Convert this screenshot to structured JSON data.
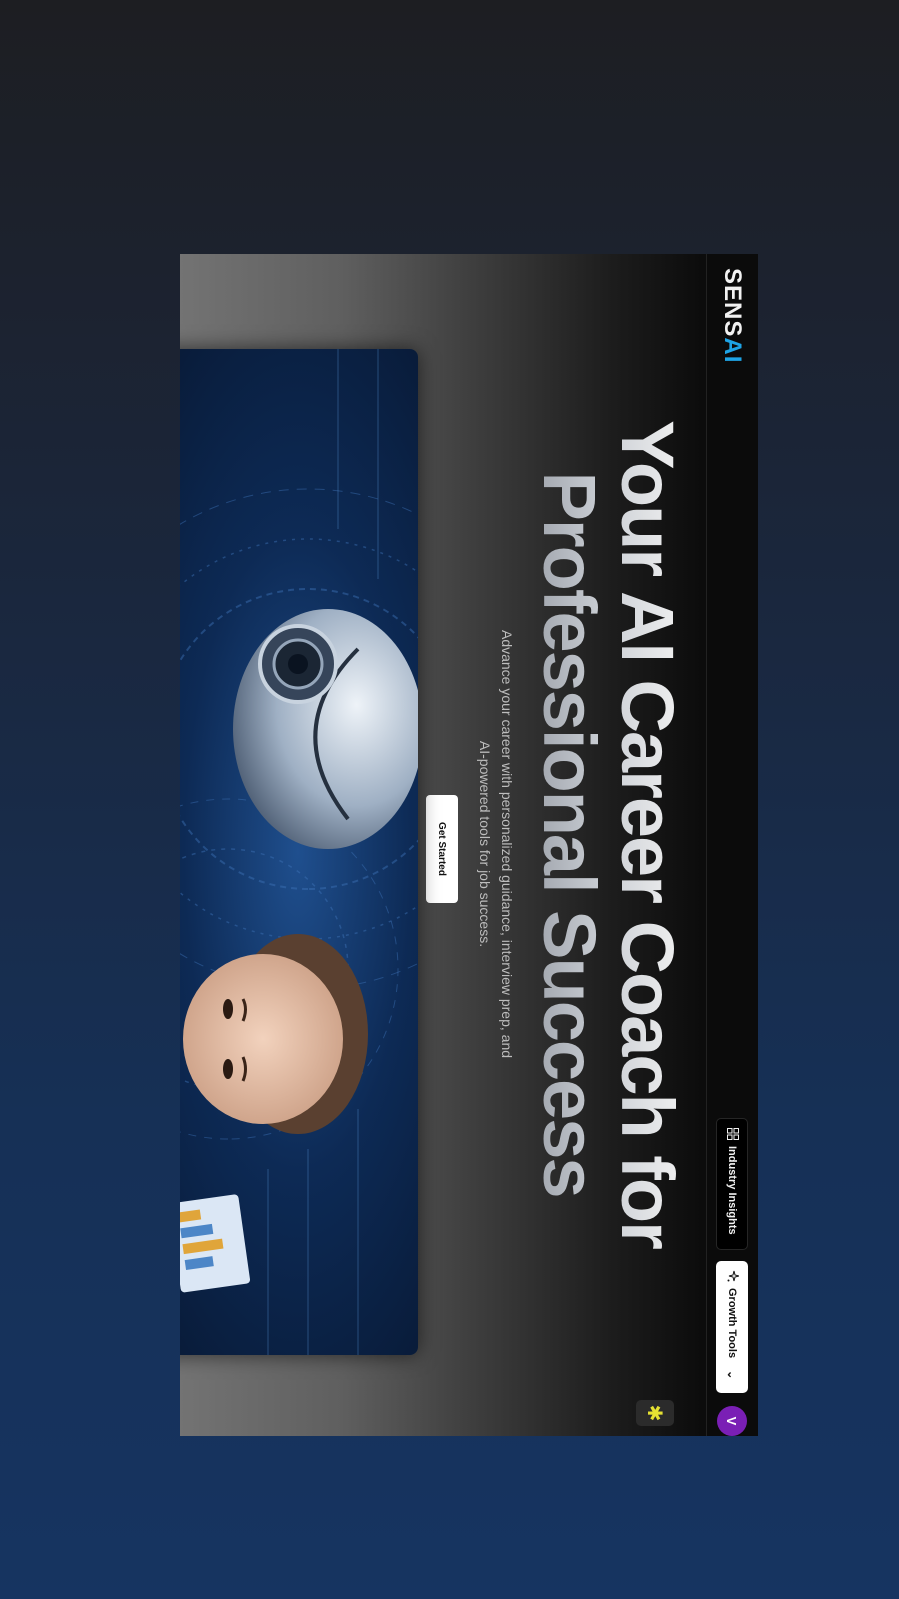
{
  "brand": {
    "name_prefix": "SEN",
    "name_mid": "S",
    "name_suffix": "AI"
  },
  "nav": {
    "industry_insights_label": "Industry Insights",
    "growth_tools_label": "Growth Tools",
    "avatar_initial": "V"
  },
  "hero": {
    "title": "Your AI Career Coach for Professional Success",
    "subtitle": "Advance your career with personalized guidance, interview prep, and AI-powered tools for job success.",
    "cta_label": "Get Started"
  },
  "icons": {
    "insights": "dashboard-grid-icon",
    "growth": "sparkles-icon",
    "chevron": "chevron-down-icon",
    "help": "sparkle-burst-icon"
  },
  "colors": {
    "accent": "#1ea4e6",
    "avatar": "#7a1fb5",
    "chip_glyph": "#e6e232"
  }
}
